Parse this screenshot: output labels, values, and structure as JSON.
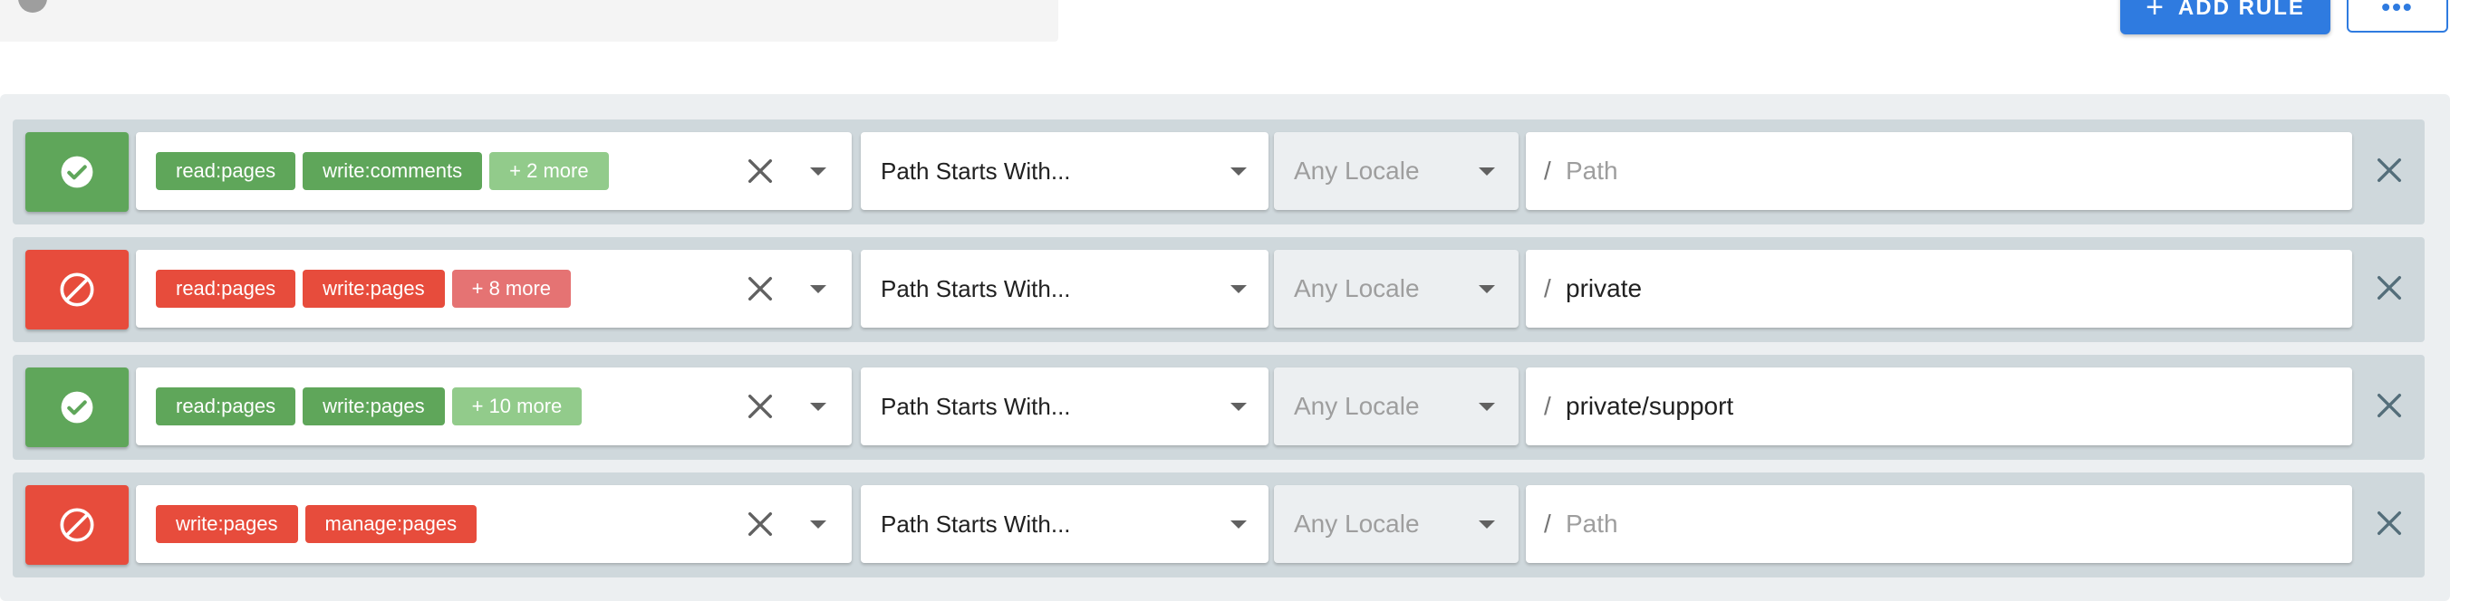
{
  "header": {
    "add_rule_label": "ADD RULE",
    "add_rule_icon": "plus-icon",
    "more_label": "•••"
  },
  "rules": [
    {
      "status": "allow",
      "permissions": [
        "read:pages",
        "write:comments"
      ],
      "more": "+ 2 more",
      "match": "Path Starts With...",
      "locale": "Any Locale",
      "path_value": "",
      "path_placeholder": "Path"
    },
    {
      "status": "deny",
      "permissions": [
        "read:pages",
        "write:pages"
      ],
      "more": "+ 8 more",
      "match": "Path Starts With...",
      "locale": "Any Locale",
      "path_value": "private",
      "path_placeholder": "Path"
    },
    {
      "status": "allow",
      "permissions": [
        "read:pages",
        "write:pages"
      ],
      "more": "+ 10 more",
      "match": "Path Starts With...",
      "locale": "Any Locale",
      "path_value": "private/support",
      "path_placeholder": "Path"
    },
    {
      "status": "deny",
      "permissions": [
        "write:pages",
        "manage:pages"
      ],
      "more": "",
      "match": "Path Starts With...",
      "locale": "Any Locale",
      "path_value": "",
      "path_placeholder": "Path"
    }
  ],
  "path_prefix": "/",
  "colors": {
    "allow": "#5fa65a",
    "deny": "#e74c3c",
    "accent": "#2f7be0"
  }
}
